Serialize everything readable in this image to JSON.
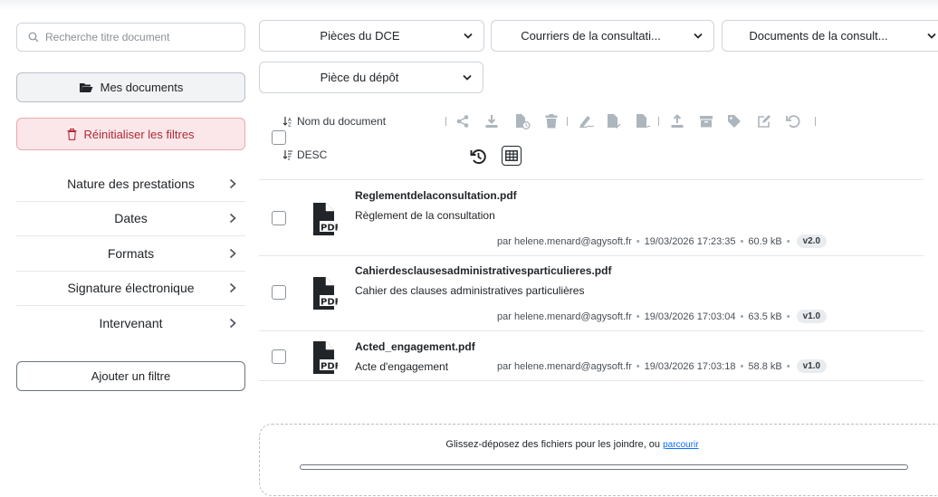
{
  "sidebar": {
    "search_placeholder": "Recherche titre document",
    "my_documents": "Mes documents",
    "reset_filters": "Réinitialiser les filtres",
    "facets": [
      "Nature des prestations",
      "Dates",
      "Formats",
      "Signature électronique",
      "Intervenant"
    ],
    "add_filter": "Ajouter un filtre"
  },
  "filters": {
    "dce": "Pièces du DCE",
    "courriers": "Courriers de la consultati...",
    "documents": "Documents de la consult...",
    "depot": "Pièce du dépôt"
  },
  "toolbar": {
    "sort_field": "Nom du document",
    "sort_order": "DESC",
    "icons": [
      "share-icon",
      "download-icon",
      "file-clock-icon",
      "trash-icon",
      "sign-icon",
      "file-check-icon",
      "file-sign-icon",
      "upload-icon",
      "archive-icon",
      "tag-icon",
      "edit-icon",
      "undo-icon"
    ]
  },
  "documents": [
    {
      "file": "Reglementdelaconsultation.pdf",
      "title": "Règlement de la consultation",
      "author": "par helene.menard@agysoft.fr",
      "date": "19/03/2026 17:23:35",
      "size": "60.9 kB",
      "version": "v2.0"
    },
    {
      "file": "Cahierdesclausesadministrativesparticulieres.pdf",
      "title": "Cahier des clauses administratives particulières",
      "author": "par helene.menard@agysoft.fr",
      "date": "19/03/2026 17:03:04",
      "size": "63.5 kB",
      "version": "v1.0"
    },
    {
      "file": "Acted_engagement.pdf",
      "title": "Acte d'engagement",
      "author": "par helene.menard@agysoft.fr",
      "date": "19/03/2026 17:03:18",
      "size": "58.8 kB",
      "version": "v1.0"
    }
  ],
  "dropzone": {
    "text": "Glissez-déposez des fichiers pour les joindre, ou",
    "link": "parcourir"
  },
  "pdf_label": "PDF"
}
